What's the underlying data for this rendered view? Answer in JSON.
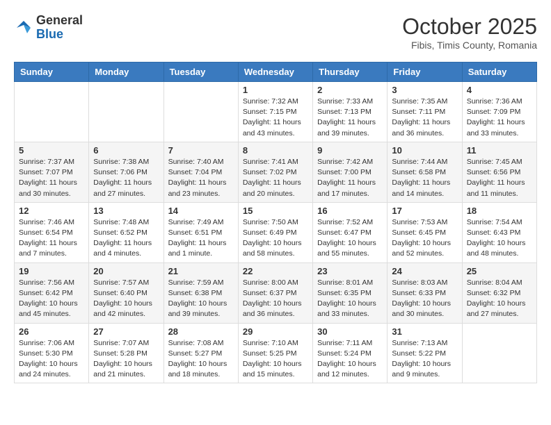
{
  "header": {
    "logo": {
      "general": "General",
      "blue": "Blue"
    },
    "title": "October 2025",
    "subtitle": "Fibis, Timis County, Romania"
  },
  "calendar": {
    "weekdays": [
      "Sunday",
      "Monday",
      "Tuesday",
      "Wednesday",
      "Thursday",
      "Friday",
      "Saturday"
    ],
    "weeks": [
      [
        {
          "day": "",
          "info": ""
        },
        {
          "day": "",
          "info": ""
        },
        {
          "day": "",
          "info": ""
        },
        {
          "day": "1",
          "info": "Sunrise: 7:32 AM\nSunset: 7:15 PM\nDaylight: 11 hours and 43 minutes."
        },
        {
          "day": "2",
          "info": "Sunrise: 7:33 AM\nSunset: 7:13 PM\nDaylight: 11 hours and 39 minutes."
        },
        {
          "day": "3",
          "info": "Sunrise: 7:35 AM\nSunset: 7:11 PM\nDaylight: 11 hours and 36 minutes."
        },
        {
          "day": "4",
          "info": "Sunrise: 7:36 AM\nSunset: 7:09 PM\nDaylight: 11 hours and 33 minutes."
        }
      ],
      [
        {
          "day": "5",
          "info": "Sunrise: 7:37 AM\nSunset: 7:07 PM\nDaylight: 11 hours and 30 minutes."
        },
        {
          "day": "6",
          "info": "Sunrise: 7:38 AM\nSunset: 7:06 PM\nDaylight: 11 hours and 27 minutes."
        },
        {
          "day": "7",
          "info": "Sunrise: 7:40 AM\nSunset: 7:04 PM\nDaylight: 11 hours and 23 minutes."
        },
        {
          "day": "8",
          "info": "Sunrise: 7:41 AM\nSunset: 7:02 PM\nDaylight: 11 hours and 20 minutes."
        },
        {
          "day": "9",
          "info": "Sunrise: 7:42 AM\nSunset: 7:00 PM\nDaylight: 11 hours and 17 minutes."
        },
        {
          "day": "10",
          "info": "Sunrise: 7:44 AM\nSunset: 6:58 PM\nDaylight: 11 hours and 14 minutes."
        },
        {
          "day": "11",
          "info": "Sunrise: 7:45 AM\nSunset: 6:56 PM\nDaylight: 11 hours and 11 minutes."
        }
      ],
      [
        {
          "day": "12",
          "info": "Sunrise: 7:46 AM\nSunset: 6:54 PM\nDaylight: 11 hours and 7 minutes."
        },
        {
          "day": "13",
          "info": "Sunrise: 7:48 AM\nSunset: 6:52 PM\nDaylight: 11 hours and 4 minutes."
        },
        {
          "day": "14",
          "info": "Sunrise: 7:49 AM\nSunset: 6:51 PM\nDaylight: 11 hours and 1 minute."
        },
        {
          "day": "15",
          "info": "Sunrise: 7:50 AM\nSunset: 6:49 PM\nDaylight: 10 hours and 58 minutes."
        },
        {
          "day": "16",
          "info": "Sunrise: 7:52 AM\nSunset: 6:47 PM\nDaylight: 10 hours and 55 minutes."
        },
        {
          "day": "17",
          "info": "Sunrise: 7:53 AM\nSunset: 6:45 PM\nDaylight: 10 hours and 52 minutes."
        },
        {
          "day": "18",
          "info": "Sunrise: 7:54 AM\nSunset: 6:43 PM\nDaylight: 10 hours and 48 minutes."
        }
      ],
      [
        {
          "day": "19",
          "info": "Sunrise: 7:56 AM\nSunset: 6:42 PM\nDaylight: 10 hours and 45 minutes."
        },
        {
          "day": "20",
          "info": "Sunrise: 7:57 AM\nSunset: 6:40 PM\nDaylight: 10 hours and 42 minutes."
        },
        {
          "day": "21",
          "info": "Sunrise: 7:59 AM\nSunset: 6:38 PM\nDaylight: 10 hours and 39 minutes."
        },
        {
          "day": "22",
          "info": "Sunrise: 8:00 AM\nSunset: 6:37 PM\nDaylight: 10 hours and 36 minutes."
        },
        {
          "day": "23",
          "info": "Sunrise: 8:01 AM\nSunset: 6:35 PM\nDaylight: 10 hours and 33 minutes."
        },
        {
          "day": "24",
          "info": "Sunrise: 8:03 AM\nSunset: 6:33 PM\nDaylight: 10 hours and 30 minutes."
        },
        {
          "day": "25",
          "info": "Sunrise: 8:04 AM\nSunset: 6:32 PM\nDaylight: 10 hours and 27 minutes."
        }
      ],
      [
        {
          "day": "26",
          "info": "Sunrise: 7:06 AM\nSunset: 5:30 PM\nDaylight: 10 hours and 24 minutes."
        },
        {
          "day": "27",
          "info": "Sunrise: 7:07 AM\nSunset: 5:28 PM\nDaylight: 10 hours and 21 minutes."
        },
        {
          "day": "28",
          "info": "Sunrise: 7:08 AM\nSunset: 5:27 PM\nDaylight: 10 hours and 18 minutes."
        },
        {
          "day": "29",
          "info": "Sunrise: 7:10 AM\nSunset: 5:25 PM\nDaylight: 10 hours and 15 minutes."
        },
        {
          "day": "30",
          "info": "Sunrise: 7:11 AM\nSunset: 5:24 PM\nDaylight: 10 hours and 12 minutes."
        },
        {
          "day": "31",
          "info": "Sunrise: 7:13 AM\nSunset: 5:22 PM\nDaylight: 10 hours and 9 minutes."
        },
        {
          "day": "",
          "info": ""
        }
      ]
    ]
  }
}
